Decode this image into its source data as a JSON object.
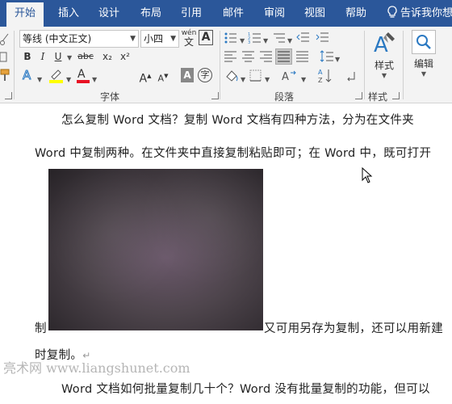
{
  "tabs": [
    {
      "label": "开始",
      "active": true
    },
    {
      "label": "插入"
    },
    {
      "label": "设计"
    },
    {
      "label": "布局"
    },
    {
      "label": "引用"
    },
    {
      "label": "邮件"
    },
    {
      "label": "审阅"
    },
    {
      "label": "视图"
    },
    {
      "label": "帮助"
    }
  ],
  "tell_me": "告诉我你想",
  "font": {
    "name": "等线 (中文正文)",
    "size": "小四",
    "wen_label": "wén",
    "wen_char": "文",
    "border_char": "A",
    "bold": "B",
    "italic": "I",
    "underline": "U",
    "strike": "abc",
    "subscript": "x₂",
    "superscript": "x²",
    "grow": "A",
    "shrink": "A",
    "clear_char": "A",
    "circle_char": "字",
    "group_name": "字体"
  },
  "paragraph": {
    "group_name": "段落"
  },
  "styles": {
    "label": "样式",
    "group_name": "样式"
  },
  "editing": {
    "label": "编辑"
  },
  "document": {
    "line1": "怎么复制 Word 文档？复制 Word 文档有四种方法，分为在文件夹",
    "line2": "Word 中复制两种。在文件夹中直接复制粘贴即可；在 Word 中，既可打开",
    "line3_prefix": "制",
    "line3_suffix": "又可用另存为复制，还可以用新建",
    "line4": "时复制。",
    "line4_mark": "↵",
    "line5": "Word 文档如何批量复制几十个？Word 没有批量复制的功能，但可以",
    "watermark": "亮术网 www.liangshunet.com"
  },
  "colors": {
    "tab_bar": "#2b579a",
    "highlight": "#ffff00",
    "font_color": "#e81123"
  }
}
